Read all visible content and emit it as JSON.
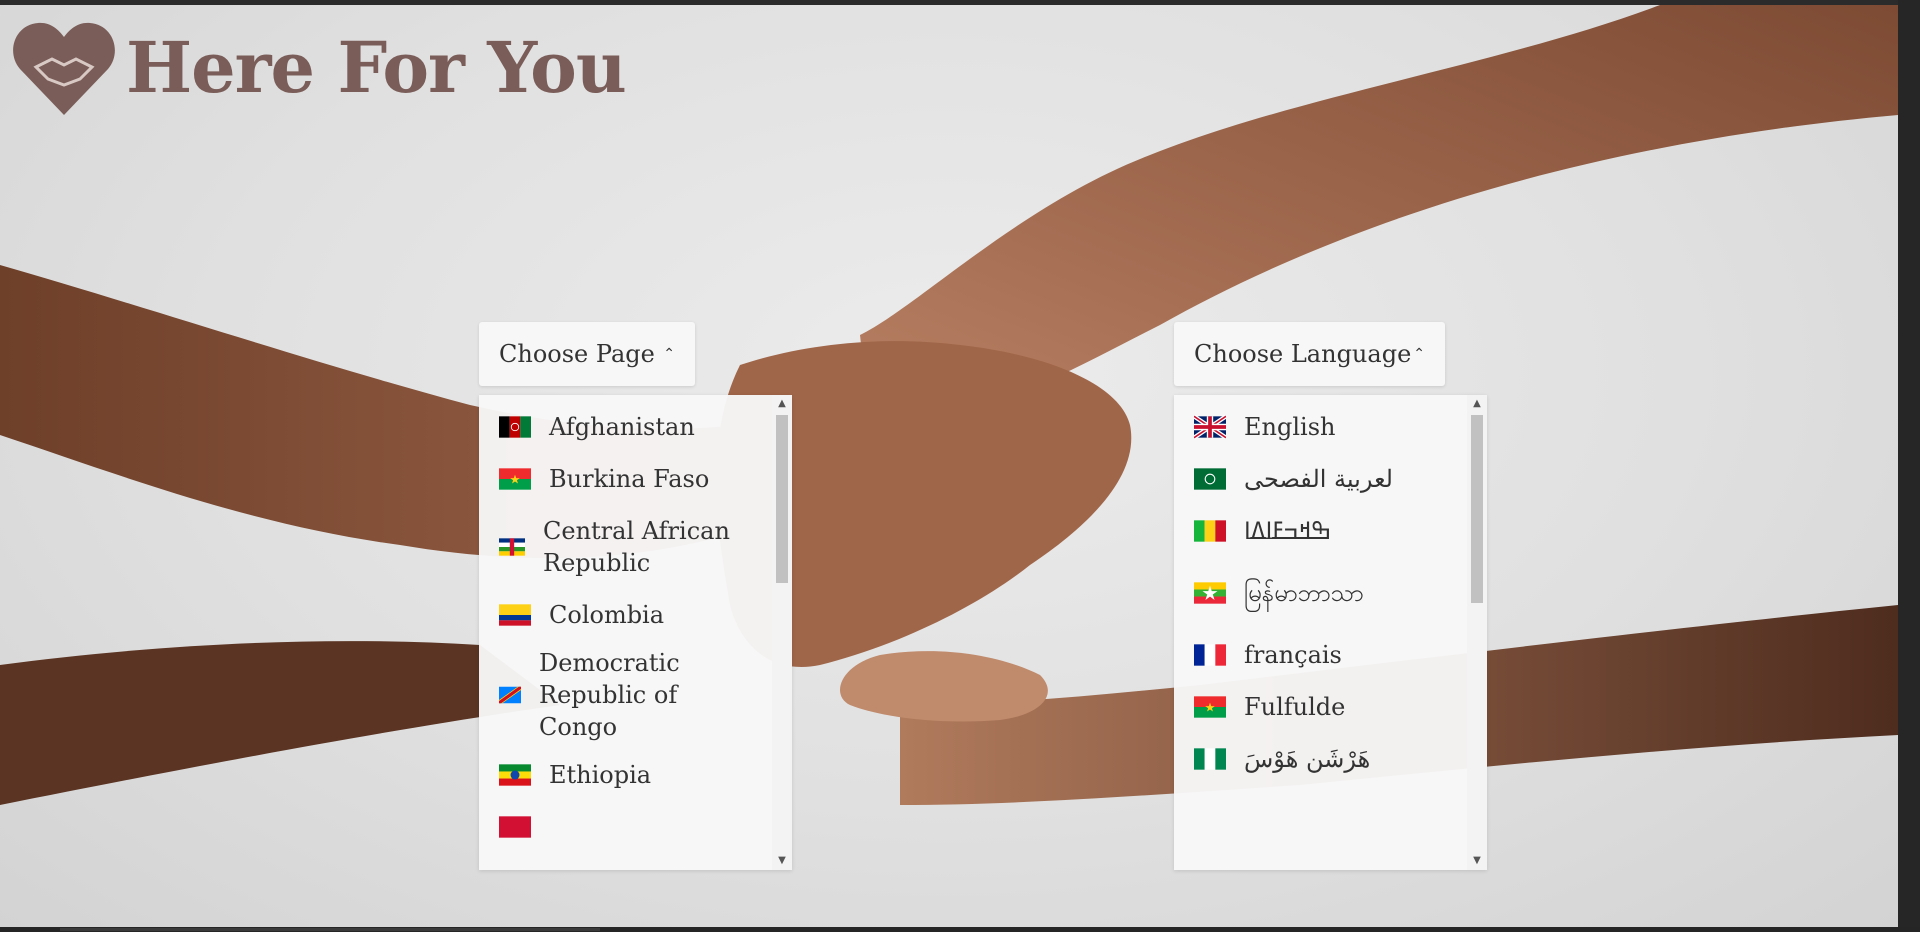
{
  "brand": {
    "name": "Here For You"
  },
  "page_select": {
    "label": "Choose Page",
    "items": [
      {
        "label": "Afghanistan",
        "flag": "afghanistan"
      },
      {
        "label": "Burkina Faso",
        "flag": "burkina-faso"
      },
      {
        "label": "Central African Republic",
        "flag": "central-african-republic"
      },
      {
        "label": "Colombia",
        "flag": "colombia"
      },
      {
        "label": "Democratic Republic of Congo",
        "flag": "dr-congo"
      },
      {
        "label": "Ethiopia",
        "flag": "ethiopia"
      }
    ]
  },
  "language_select": {
    "label": "Choose Language",
    "items": [
      {
        "label": "English",
        "flag": "united-kingdom"
      },
      {
        "label": "لعربية الفصحى",
        "flag": "arabic"
      },
      {
        "label": "ߒߞߏߓߊߡߊ",
        "flag": "mali"
      },
      {
        "label": "မြန်မာဘာသာ",
        "flag": "myanmar"
      },
      {
        "label": "français",
        "flag": "france"
      },
      {
        "label": "Fulfulde",
        "flag": "burkina-faso"
      },
      {
        "label": "هَرْشَن هَوْسَ",
        "flag": "nigeria"
      }
    ]
  },
  "colors": {
    "brand": "#7a5d58",
    "panel": "#f7f7f7",
    "text": "#333333"
  }
}
